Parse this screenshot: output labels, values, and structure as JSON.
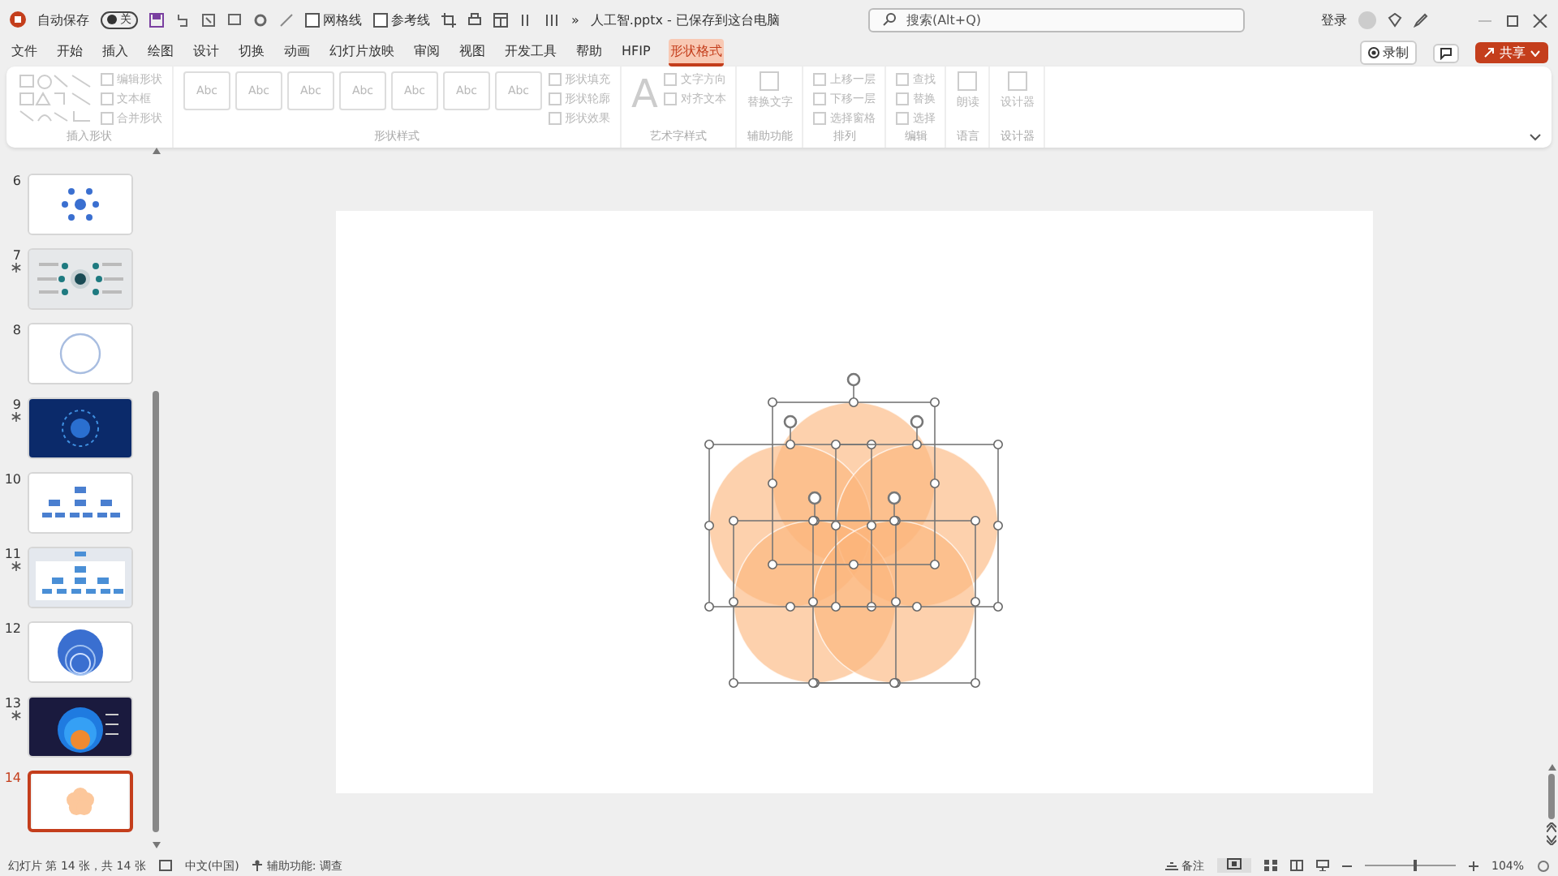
{
  "titlebar": {
    "autosave_label": "自动保存",
    "autosave_on": false,
    "toggle_text": "关",
    "quick_checks": [
      {
        "label": "网格线",
        "checked": false
      },
      {
        "label": "参考线",
        "checked": false
      }
    ],
    "overflow": "»",
    "title": "人工智.pptx - 已保存到这台电脑",
    "search_placeholder": "搜索(Alt+Q)",
    "sign_in": "登录"
  },
  "menu": {
    "tabs": [
      {
        "label": "文件",
        "selected": false
      },
      {
        "label": "开始",
        "selected": false
      },
      {
        "label": "插入",
        "selected": false
      },
      {
        "label": "绘图",
        "selected": false
      },
      {
        "label": "设计",
        "selected": false
      },
      {
        "label": "切换",
        "selected": false
      },
      {
        "label": "动画",
        "selected": false
      },
      {
        "label": "幻灯片放映",
        "selected": false
      },
      {
        "label": "审阅",
        "selected": false
      },
      {
        "label": "视图",
        "selected": false
      },
      {
        "label": "开发工具",
        "selected": false
      },
      {
        "label": "帮助",
        "selected": false
      },
      {
        "label": "HFIP",
        "selected": false
      },
      {
        "label": "形状格式",
        "selected": true
      }
    ],
    "record": "录制",
    "share": "共享"
  },
  "ribbon": {
    "groups": [
      {
        "label": "插入形状",
        "kind": "shapes",
        "commands": [
          "编辑形状",
          "文本框",
          "合并形状"
        ]
      },
      {
        "label": "形状样式",
        "kind": "styles",
        "gallery": [
          "Abc",
          "Abc",
          "Abc",
          "Abc",
          "Abc",
          "Abc",
          "Abc"
        ],
        "commands": [
          "形状填充",
          "形状轮廓",
          "形状效果"
        ]
      },
      {
        "label": "艺术字样式",
        "kind": "wordart",
        "glyph": "A",
        "commands": [
          "文字方向",
          "对齐文本"
        ]
      },
      {
        "label": "辅助功能",
        "kind": "simple",
        "commands": [
          "替换文字"
        ]
      },
      {
        "label": "排列",
        "kind": "simple",
        "commands": [
          "上移一层",
          "下移一层",
          "选择窗格"
        ]
      },
      {
        "label": "编辑",
        "kind": "simple",
        "commands": [
          "查找",
          "替换",
          "选择"
        ]
      },
      {
        "label": "语言",
        "kind": "simple",
        "commands": [
          "朗读"
        ]
      },
      {
        "label": "设计器",
        "kind": "simple",
        "commands": [
          "设计器"
        ]
      }
    ]
  },
  "slides": [
    {
      "number": "6",
      "animated": false,
      "selected": false,
      "kind": "dots"
    },
    {
      "number": "7",
      "animated": true,
      "selected": false,
      "kind": "hub"
    },
    {
      "number": "8",
      "animated": false,
      "selected": false,
      "kind": "ring"
    },
    {
      "number": "9",
      "animated": true,
      "selected": false,
      "kind": "tech"
    },
    {
      "number": "10",
      "animated": false,
      "selected": false,
      "kind": "tree"
    },
    {
      "number": "11",
      "animated": true,
      "selected": false,
      "kind": "tree-framed"
    },
    {
      "number": "12",
      "animated": false,
      "selected": false,
      "kind": "circles"
    },
    {
      "number": "13",
      "animated": true,
      "selected": false,
      "kind": "layers"
    },
    {
      "number": "14",
      "animated": false,
      "selected": true,
      "kind": "flower"
    }
  ],
  "status_bar": {
    "slide_info": "幻灯片 第 14 张，共 14 张",
    "language": "中文(中国)",
    "accessibility": "辅助功能: 调查",
    "notes": "备注",
    "zoom": {
      "level": 0.55
    },
    "zoom_text": "104%"
  }
}
